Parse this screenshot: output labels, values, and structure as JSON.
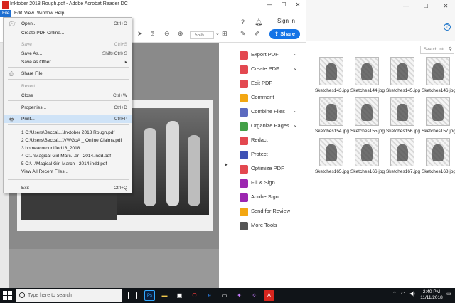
{
  "acrobat": {
    "title": "Inktober 2018 Rough.pdf - Adobe Acrobat Reader DC",
    "menus": [
      "File",
      "Edit",
      "View",
      "Window",
      "Help"
    ],
    "sign_in": "Sign In",
    "zoom_value": "55%",
    "share_label": "Share",
    "tools": [
      {
        "label": "Export PDF",
        "color": "#e34850",
        "chevron": true
      },
      {
        "label": "Create PDF",
        "color": "#e34850",
        "chevron": true
      },
      {
        "label": "Edit PDF",
        "color": "#e34850",
        "chevron": false
      },
      {
        "label": "Comment",
        "color": "#f3a712",
        "chevron": false
      },
      {
        "label": "Combine Files",
        "color": "#5c6bc0",
        "chevron": true
      },
      {
        "label": "Organize Pages",
        "color": "#43a047",
        "chevron": true
      },
      {
        "label": "Redact",
        "color": "#e34850",
        "chevron": false
      },
      {
        "label": "Protect",
        "color": "#3f51b5",
        "chevron": false
      },
      {
        "label": "Optimize PDF",
        "color": "#e34850",
        "chevron": false
      },
      {
        "label": "Fill & Sign",
        "color": "#9c27b0",
        "chevron": false
      },
      {
        "label": "Adobe Sign",
        "color": "#9c27b0",
        "chevron": false
      },
      {
        "label": "Send for Review",
        "color": "#f3a712",
        "chevron": false
      },
      {
        "label": "More Tools",
        "color": "#555555",
        "chevron": false
      }
    ]
  },
  "file_menu": {
    "items": [
      {
        "label": "Open...",
        "shortcut": "Ctrl+O",
        "disabled": false
      },
      {
        "label": "Create PDF Online...",
        "shortcut": "",
        "disabled": false
      },
      {
        "label": "Save",
        "shortcut": "Ctrl+S",
        "disabled": true
      },
      {
        "label": "Save As...",
        "shortcut": "Shift+Ctrl+S",
        "disabled": false
      },
      {
        "label": "Save as Other",
        "shortcut": "▸",
        "disabled": false
      },
      {
        "label": "Share File",
        "shortcut": "",
        "disabled": false
      },
      {
        "label": "Revert",
        "shortcut": "",
        "disabled": true
      },
      {
        "label": "Close",
        "shortcut": "Ctrl+W",
        "disabled": false
      },
      {
        "label": "Properties...",
        "shortcut": "Ctrl+D",
        "disabled": false
      },
      {
        "label": "Print...",
        "shortcut": "Ctrl+P",
        "disabled": false
      },
      {
        "label": "1 C:\\Users\\Becca\\...\\Inktober 2018 Rough.pdf",
        "shortcut": "",
        "disabled": false
      },
      {
        "label": "2 C:\\Users\\Becca\\...\\VWGoA _ Online Claims.pdf",
        "shortcut": "",
        "disabled": false
      },
      {
        "label": "3 homeacordunified18_2018",
        "shortcut": "",
        "disabled": false
      },
      {
        "label": "4 C:...\\Magical Girl Marc...er - 2014.indd.pdf",
        "shortcut": "",
        "disabled": false
      },
      {
        "label": "5 C:\\...\\Magical Girl March - 2014.indd.pdf",
        "shortcut": "",
        "disabled": false
      },
      {
        "label": "View All Recent Files...",
        "shortcut": "",
        "disabled": false
      },
      {
        "label": "Exit",
        "shortcut": "Ctrl+Q",
        "disabled": false
      }
    ]
  },
  "explorer": {
    "search_placeholder": "Search Intr...",
    "files": [
      "Sketches143.jpg",
      "Sketches144.jpg",
      "Sketches145.jpg",
      "Sketches146.jpg",
      "Sketches154.jpg",
      "Sketches155.jpg",
      "Sketches156.jpg",
      "Sketches157.jpg",
      "Sketches165.jpg",
      "Sketches166.jpg",
      "Sketches167.jpg",
      "Sketches168.jpg"
    ]
  },
  "taskbar": {
    "search_placeholder": "Type here to search",
    "time": "2:40 PM",
    "date": "11/11/2018"
  }
}
